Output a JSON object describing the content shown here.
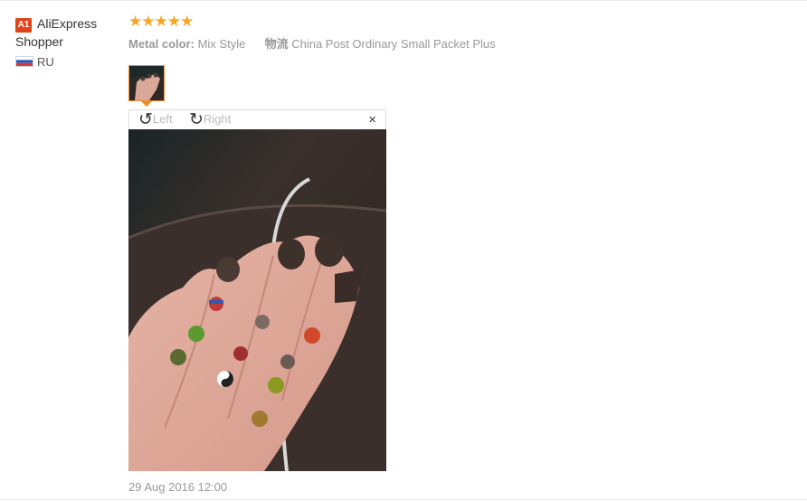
{
  "buyer": {
    "badge": "A1",
    "name": "AliExpress Shopper",
    "country": "RU"
  },
  "review": {
    "rating": 5,
    "stars": "★★★★★",
    "metal_color_label": "Metal color:",
    "metal_color_value": "Mix Style",
    "shipping_label": "物流",
    "shipping_value": "China Post Ordinary Small Packet Plus",
    "date": "29 Aug 2016 12:00"
  },
  "viewer": {
    "rotate_left_label": "Left",
    "rotate_right_label": "Right",
    "rotate_left_icon": "↺",
    "rotate_right_icon": "↻",
    "close_icon": "×"
  },
  "colors": {
    "accent": "#f08a24",
    "badge": "#e0431a",
    "stars": "#f5a623"
  }
}
